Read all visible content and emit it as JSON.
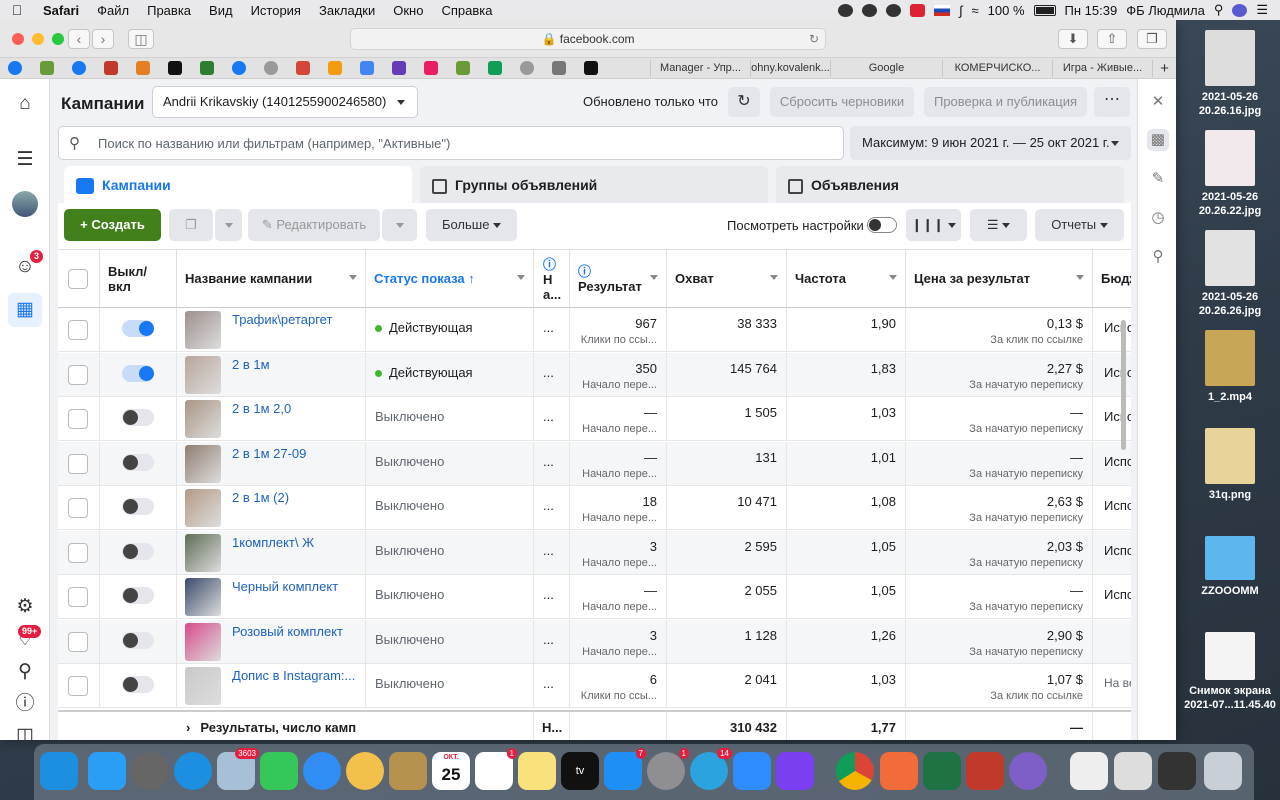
{
  "menubar": {
    "items": [
      "Safari",
      "Файл",
      "Правка",
      "Вид",
      "История",
      "Закладки",
      "Окно",
      "Справка"
    ],
    "battery": "100 %",
    "clock": "Пн 15:39",
    "user": "ФБ Людмила"
  },
  "browser": {
    "url": "facebook.com",
    "tabs": [
      "Manager - Упр...",
      "ohny.kovalenk...",
      "Google",
      "КОМЕРЧИСКО...",
      "Игра - Живые..."
    ]
  },
  "header": {
    "title": "Кампании",
    "account": "Andrii Krikavskiy (1401255900246580)",
    "updated": "Обновлено только что",
    "reset_drafts": "Сбросить черновики",
    "review_publish": "Проверка и публикация"
  },
  "search": {
    "placeholder": "Поиск по названию или фильтрам (например, \"Активные\")",
    "date_range": "Максимум: 9 июн 2021 г. — 25 окт 2021 г."
  },
  "tabs": [
    "Кампании",
    "Группы объявлений",
    "Объявления"
  ],
  "toolbar": {
    "create": "Создать",
    "edit": "Редактировать",
    "more": "Больше",
    "view_settings": "Посмотреть настройки",
    "reports": "Отчеты"
  },
  "sidebar": {
    "notifications_badge": "3",
    "bell_badge": "99+"
  },
  "table": {
    "headers": {
      "toggle": "Выкл/ вкл",
      "name": "Название кампании",
      "status": "Статус показа ↑",
      "narrow_top": "Н",
      "narrow_bottom": "а...",
      "result": "Результат",
      "reach": "Охват",
      "frequency": "Частота",
      "cost": "Цена за результат",
      "budget": "Бюдж"
    },
    "rows": [
      {
        "name": "Трафик\\ретаргет",
        "status": "Действующая",
        "active": true,
        "n": "...",
        "result": "967",
        "result_sub": "Клики по ссы...",
        "reach": "38 333",
        "freq": "1,90",
        "cost": "0,13 $",
        "cost_sub": "За клик по ссылке",
        "budget": "Испо"
      },
      {
        "name": "2 в 1м",
        "status": "Действующая",
        "active": true,
        "n": "...",
        "result": "350",
        "result_sub": "Начало пере...",
        "reach": "145 764",
        "freq": "1,83",
        "cost": "2,27 $",
        "cost_sub": "За начатую переписку",
        "budget": "Испо"
      },
      {
        "name": "2 в 1м 2,0",
        "status": "Выключено",
        "active": false,
        "n": "...",
        "result": "—",
        "result_sub": "Начало пере...",
        "reach": "1 505",
        "freq": "1,03",
        "cost": "—",
        "cost_sub": "За начатую переписку",
        "budget": "Испо"
      },
      {
        "name": "2 в 1м 27-09",
        "status": "Выключено",
        "active": false,
        "n": "...",
        "result": "—",
        "result_sub": "Начало пере...",
        "reach": "131",
        "freq": "1,01",
        "cost": "—",
        "cost_sub": "За начатую переписку",
        "budget": "Испо"
      },
      {
        "name": "2 в 1м (2)",
        "status": "Выключено",
        "active": false,
        "n": "...",
        "result": "18",
        "result_sub": "Начало пере...",
        "reach": "10 471",
        "freq": "1,08",
        "cost": "2,63 $",
        "cost_sub": "За начатую переписку",
        "budget": "Испо"
      },
      {
        "name": "1комплект\\ Ж",
        "status": "Выключено",
        "active": false,
        "n": "...",
        "result": "3",
        "result_sub": "Начало пере...",
        "reach": "2 595",
        "freq": "1,05",
        "cost": "2,03 $",
        "cost_sub": "За начатую переписку",
        "budget": "Испо"
      },
      {
        "name": "Черный комплект",
        "status": "Выключено",
        "active": false,
        "n": "...",
        "result": "—",
        "result_sub": "Начало пере...",
        "reach": "2 055",
        "freq": "1,05",
        "cost": "—",
        "cost_sub": "За начатую переписку",
        "budget": "Испо"
      },
      {
        "name": "Розовый комплект",
        "status": "Выключено",
        "active": false,
        "n": "...",
        "result": "3",
        "result_sub": "Начало пере...",
        "reach": "1 128",
        "freq": "1,26",
        "cost": "2,90 $",
        "cost_sub": "За начатую переписку",
        "budget": ""
      },
      {
        "name": "Допис в Instagram:...",
        "status": "Выключено",
        "active": false,
        "n": "...",
        "result": "6",
        "result_sub": "Клики по ссы...",
        "reach": "2 041",
        "freq": "1,03",
        "cost": "1,07 $",
        "cost_sub": "За клик по ссылке",
        "budget": "На ве"
      }
    ],
    "footer": {
      "label": "Результаты, число камп",
      "n": "Н...",
      "reach": "310 432",
      "freq": "1,77",
      "cost": "—"
    }
  },
  "desktop_files": [
    {
      "name1": "2021-05-26",
      "name2": "20.26.16.jpg"
    },
    {
      "name1": "2021-05-26",
      "name2": "20.26.22.jpg"
    },
    {
      "name1": "2021-05-26",
      "name2": "20.26.26.jpg"
    },
    {
      "name1": "1_2.mp4",
      "name2": ""
    },
    {
      "name1": "31q.png",
      "name2": ""
    },
    {
      "name1": "ZZOOOMM",
      "name2": ""
    },
    {
      "name1": "Снимок экрана",
      "name2": "2021-07...11.45.40"
    }
  ],
  "dock": {
    "badges": {
      "mail": "3603",
      "calendar_day": "25",
      "calendar_month": "ОКТ.",
      "reminders": "1",
      "appstore": "7",
      "settings": "1",
      "telegram": "14"
    }
  },
  "colors": {
    "primary": "#1877f2",
    "create": "#42801b",
    "active_dot": "#42b72a"
  }
}
